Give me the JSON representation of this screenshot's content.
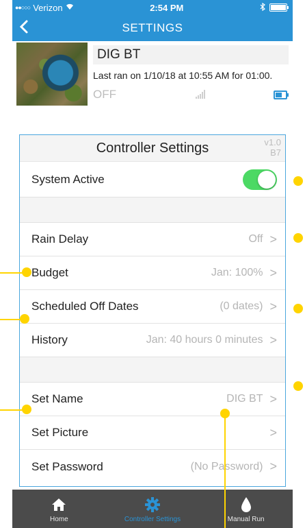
{
  "status_bar": {
    "carrier": "Verizon",
    "time": "2:54 PM"
  },
  "nav": {
    "title": "SETTINGS"
  },
  "device": {
    "name": "DIG BT",
    "last_ran": "Last ran on 1/10/18 at 10:55 AM for 01:00.",
    "state": "OFF"
  },
  "panel": {
    "title": "Controller Settings",
    "version_line1": "v1.0",
    "version_line2": "B7"
  },
  "rows": {
    "system_active": {
      "label": "System Active",
      "enabled": true
    },
    "rain_delay": {
      "label": "Rain Delay",
      "value": "Off"
    },
    "budget": {
      "label": "Budget",
      "value": "Jan: 100%"
    },
    "scheduled_off_dates": {
      "label": "Scheduled Off Dates",
      "value": "(0 dates)"
    },
    "history": {
      "label": "History",
      "value": "Jan: 40 hours 0 minutes"
    },
    "set_name": {
      "label": "Set Name",
      "value": "DIG BT"
    },
    "set_picture": {
      "label": "Set Picture",
      "value": ""
    },
    "set_password": {
      "label": "Set Password",
      "value": "(No Password)"
    }
  },
  "chevron": ">",
  "tabs": [
    {
      "label": "Home",
      "icon": "home-icon"
    },
    {
      "label": "Controller Settings",
      "icon": "gear-icon"
    },
    {
      "label": "Manual Run",
      "icon": "water-drop-icon"
    }
  ],
  "colors": {
    "brand_blue": "#2a93d5",
    "toggle_green": "#4cd964",
    "annotation_yellow": "#ffd400",
    "tabbar": "#4b4b4b"
  }
}
